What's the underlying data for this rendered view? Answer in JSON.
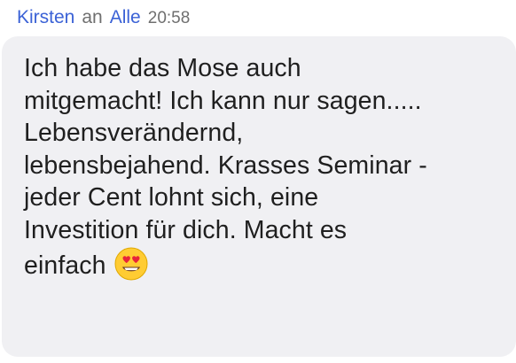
{
  "message": {
    "sender": "Kirsten",
    "connector": "an",
    "recipient": "Alle",
    "time": "20:58",
    "lines": [
      "Ich habe das Mose auch",
      "mitgemacht! Ich kann nur sagen.....",
      "Lebensverändernd,",
      "lebensbejahend. Krasses Seminar -",
      "jeder Cent lohnt sich, eine",
      "Investition für dich. Macht es",
      "einfach"
    ],
    "emoji": "heart-eyes-emoji"
  },
  "colors": {
    "name_blue": "#3b62d6",
    "meta_gray": "#6f6f6f",
    "bubble_bg": "#f0f0f3",
    "text": "#1f1f1f",
    "emoji_face": "#ffcc33",
    "emoji_heart": "#e8233a"
  }
}
